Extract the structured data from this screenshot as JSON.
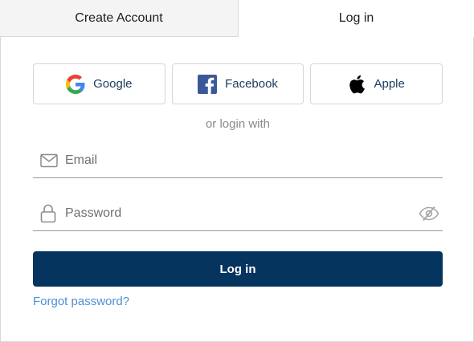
{
  "tabs": {
    "create_account": "Create Account",
    "log_in": "Log in"
  },
  "social": {
    "google": {
      "label": "Google",
      "icon": "google-icon"
    },
    "facebook": {
      "label": "Facebook",
      "icon": "facebook-icon",
      "color": "#3b5998"
    },
    "apple": {
      "label": "Apple",
      "icon": "apple-icon",
      "color": "#000000"
    }
  },
  "divider_text": "or login with",
  "form": {
    "email": {
      "placeholder": "Email",
      "value": "",
      "icon": "mail-icon"
    },
    "password": {
      "placeholder": "Password",
      "value": "",
      "icon": "lock-icon",
      "toggle_icon": "eye-slash-icon"
    },
    "submit_label": "Log in",
    "forgot_label": "Forgot password?"
  },
  "colors": {
    "primary": "#05345f",
    "link": "#4a90d9",
    "social_text": "#1b3a5c"
  }
}
